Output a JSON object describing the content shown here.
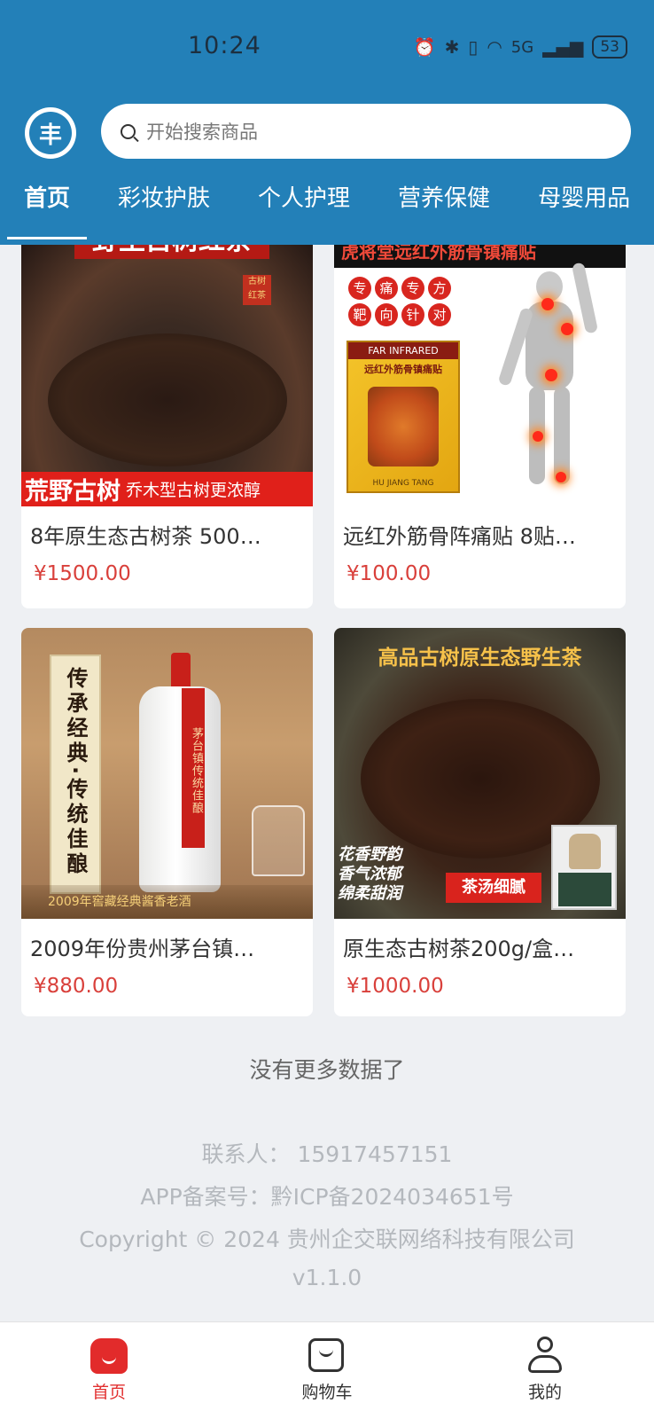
{
  "status_bar": {
    "time": "10:24",
    "network": "5G",
    "battery": "53"
  },
  "header": {
    "logo_glyph": "丰",
    "search_placeholder": "开始搜索商品",
    "tabs": [
      "首页",
      "彩妆护肤",
      "个人护理",
      "营养保健",
      "母婴用品"
    ],
    "active_tab": 0
  },
  "products": [
    {
      "name": "8年原生态古树茶 500…",
      "price": "¥1500.00",
      "image": {
        "top_text": "野生古树红茶",
        "seal": "古树\n红茶",
        "bottom_main": "荒野古树",
        "bottom_sub": "乔木型古树更浓醇"
      }
    },
    {
      "name": "远红外筋骨阵痛贴 8贴…",
      "price": "¥100.00",
      "image": {
        "top_text": "虎将堂远红外筋骨镇痛贴",
        "tags": [
          "专",
          "痛",
          "专",
          "方",
          "靶",
          "向",
          "针",
          "对"
        ],
        "box_title": "FAR INFRARED",
        "box_sub": "远红外筋骨镇痛贴",
        "box_brand": "HU JIANG TANG"
      }
    },
    {
      "name": "2009年份贵州茅台镇…",
      "price": "¥880.00",
      "image": {
        "scroll_text": "传承经典·传统佳酿",
        "ribbon_text": "茅台镇传统佳酿",
        "bottom_text": "2009年窖藏经典酱香老酒"
      }
    },
    {
      "name": "原生态古树茶200g/盒…",
      "price": "¥1000.00",
      "image": {
        "top_text": "高品古树原生态野生茶",
        "poem_lines": [
          "花香野韵",
          "香气浓郁",
          "绵柔甜润"
        ],
        "badge": "茶汤细腻"
      }
    }
  ],
  "no_more_text": "没有更多数据了",
  "footer": {
    "contact": "联系人：  15917457151",
    "icp": "APP备案号：黔ICP备2024034651号",
    "copyright": "Copyright © 2024 贵州企交联网络科技有限公司",
    "version": "v1.1.0"
  },
  "bottom_nav": [
    {
      "label": "首页",
      "icon": "home-icon",
      "active": true
    },
    {
      "label": "购物车",
      "icon": "cart-icon",
      "active": false
    },
    {
      "label": "我的",
      "icon": "user-icon",
      "active": false
    }
  ],
  "colors": {
    "header": "#2380b8",
    "price": "#d9403b",
    "active_nav": "#e22b2b"
  }
}
